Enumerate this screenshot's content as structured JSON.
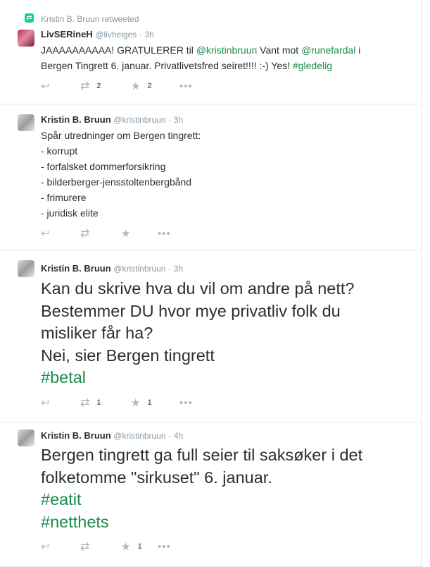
{
  "tweets": [
    {
      "retweet_context": "Kristin B. Bruun retweeted",
      "fullname": "LivSERineH",
      "username": "@livhelges",
      "time": "3h",
      "lines": [
        [
          "JAAAAAAAAAA! GRATULERER til ",
          "@kristinbruun",
          "  Vant mot ",
          "@runefardal",
          " i"
        ],
        [
          "Bergen Tingrett 6. januar. Privatlivetsfred seiret!!!! :-) Yes! ",
          "#gledelig"
        ]
      ],
      "retweets": "2",
      "favorites": "2"
    },
    {
      "fullname": "Kristin B. Bruun",
      "username": "@kristinbruun",
      "time": "3h",
      "lines": [
        "Spår utredninger om Bergen tingrett:",
        "- korrupt",
        "- forfalsket dommerforsikring",
        "- bilderberger-jensstoltenbergbånd",
        "- frimurere",
        "- juridisk elite"
      ],
      "retweets": "",
      "favorites": ""
    },
    {
      "fullname": "Kristin B. Bruun",
      "username": "@kristinbruun",
      "time": "3h",
      "lines": [
        "Kan du skrive hva du vil om andre på nett?",
        "Bestemmer DU hvor mye privatliv folk du",
        "misliker får ha?",
        "Nei, sier Bergen tingrett",
        "#betal"
      ],
      "retweets": "1",
      "favorites": "1"
    },
    {
      "fullname": "Kristin B. Bruun",
      "username": "@kristinbruun",
      "time": "4h",
      "lines": [
        "Bergen tingrett ga full seier til saksøker i det",
        "folketomme \"sirkuset\" 6. januar.",
        "#eatit",
        "#netthets"
      ],
      "retweets": "",
      "favorites": "1"
    }
  ],
  "separator": "·",
  "icons": {
    "reply": "reply-arrow-icon",
    "retweet": "retweet-icon",
    "favorite": "star-icon",
    "more": "more-dots-icon"
  },
  "colors": {
    "hashtag_link": "#1b8a4d",
    "retweet_badge": "#19cf86",
    "muted_text": "#8899a6"
  }
}
